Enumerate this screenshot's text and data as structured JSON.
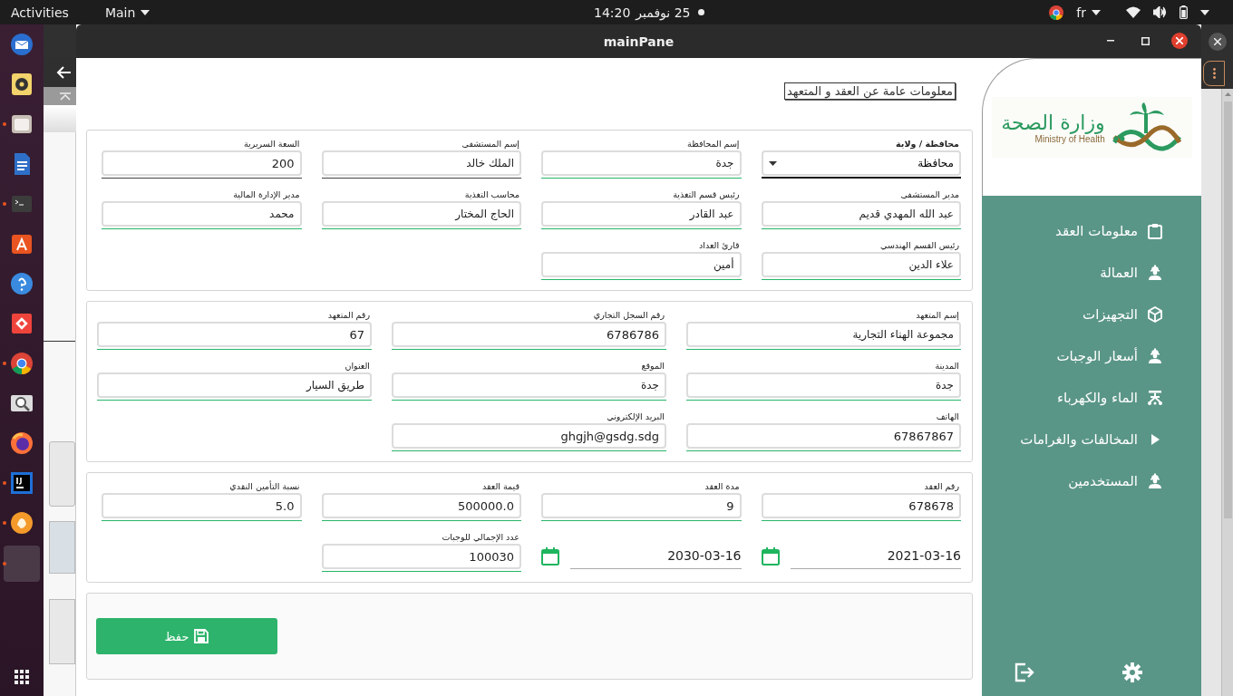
{
  "top_bar": {
    "activities": "Activities",
    "app_menu": "Main",
    "time": "14:20",
    "date": "25 نوفمبر",
    "language": "fr"
  },
  "dock": [
    {
      "kind": "mail",
      "running": false
    },
    {
      "kind": "music",
      "running": false
    },
    {
      "kind": "files",
      "running": true
    },
    {
      "kind": "document",
      "running": false
    },
    {
      "kind": "terminal",
      "running": true
    },
    {
      "kind": "store",
      "running": false
    },
    {
      "kind": "help",
      "running": false
    },
    {
      "kind": "remote",
      "running": false
    },
    {
      "kind": "chrome",
      "running": true
    },
    {
      "kind": "magnifier",
      "running": false
    },
    {
      "kind": "firefox",
      "running": false
    },
    {
      "kind": "ide",
      "running": true
    },
    {
      "kind": "hand",
      "running": true
    },
    {
      "kind": "blank",
      "running": true
    }
  ],
  "window": {
    "title": "mainPane"
  },
  "heading": "معلومات عامة عن العقد و المتعهد",
  "sections": [
    {
      "rows": [
        [
          {
            "kind": "select",
            "label": "محافظة / ولاية",
            "value": "محافظة"
          },
          {
            "kind": "text",
            "label": "إسم المحافظة",
            "value": "جدة",
            "valid": true
          },
          {
            "kind": "text",
            "label": "إسم المستشفى",
            "value": "الملك خالد",
            "valid": false
          },
          {
            "kind": "text",
            "label": "السعة السريرية",
            "value": "200",
            "valid": false
          }
        ],
        [
          {
            "kind": "text",
            "label": "مدير المستشفى",
            "value": "عبد الله المهدي قديم",
            "valid": true
          },
          {
            "kind": "text",
            "label": "رئيس قسم التغذية",
            "value": "عبد القادر",
            "valid": true
          },
          {
            "kind": "text",
            "label": "محاسب التغذية",
            "value": "الحاج المختار",
            "valid": true
          },
          {
            "kind": "text",
            "label": "مدير الإدارة المالية",
            "value": "محمد",
            "valid": true
          }
        ],
        [
          {
            "kind": "text",
            "label": "رئيس القسم الهندسي",
            "value": "علاء الدين",
            "valid": true
          },
          {
            "kind": "text",
            "label": "قارئ العداد",
            "value": "أمين",
            "valid": true
          }
        ]
      ]
    },
    {
      "rows": [
        [
          {
            "kind": "text",
            "label": "إسم المتعهد",
            "value": "مجموعة الهناء التجارية",
            "valid": true
          },
          {
            "kind": "text",
            "label": "رقم السجل التجاري",
            "value": "6786786",
            "valid": true
          },
          {
            "kind": "text",
            "label": "رقم المتعهد",
            "value": "67",
            "valid": true
          }
        ],
        [
          {
            "kind": "text",
            "label": "المدينة",
            "value": "جدة",
            "valid": true
          },
          {
            "kind": "text",
            "label": "الموقع",
            "value": "جدة",
            "valid": true
          },
          {
            "kind": "text",
            "label": "العنوان",
            "value": "طريق السيار",
            "valid": true
          }
        ],
        [
          {
            "kind": "text",
            "label": "الهاتف",
            "value": "67867867",
            "valid": true
          },
          {
            "kind": "text",
            "label": "البريد الإلكتروني",
            "value": "ghgjh@gsdg.sdg",
            "valid": true
          }
        ]
      ]
    },
    {
      "rows": [
        [
          {
            "kind": "text",
            "label": "رقم العقد",
            "value": "678678",
            "valid": true
          },
          {
            "kind": "text",
            "label": "مدة العقد",
            "value": "9",
            "valid": true
          },
          {
            "kind": "text",
            "label": "قيمة العقد",
            "value": "500000.0",
            "valid": true
          },
          {
            "kind": "text",
            "label": "نسبة التأمين النقدي",
            "value": "5.0",
            "valid": true
          }
        ],
        [
          {
            "kind": "date",
            "value": "2021-03-16"
          },
          {
            "kind": "date",
            "value": "2030-03-16"
          },
          {
            "kind": "text",
            "label": "عدد الإجمالي للوجبات",
            "value": "100030",
            "valid": true
          }
        ]
      ]
    }
  ],
  "save_button": "حفظ",
  "logo": {
    "arabic": "وزارة الصحة",
    "english": "Ministry of Health"
  },
  "nav": [
    {
      "kind": "clipboard",
      "label": "معلومات العقد"
    },
    {
      "kind": "worker",
      "label": "العمالة"
    },
    {
      "kind": "box",
      "label": "التجهيزات"
    },
    {
      "kind": "worker",
      "label": "أسعار الوجبات"
    },
    {
      "kind": "network",
      "label": "الماء والكهرباء"
    },
    {
      "kind": "submenu",
      "label": "المخالفات والغرامات"
    },
    {
      "kind": "worker",
      "label": "المستخدمين"
    }
  ]
}
